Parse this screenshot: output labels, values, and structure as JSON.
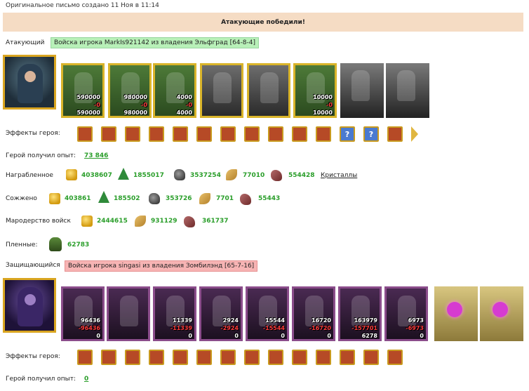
{
  "header": {
    "created_text": "Оригинальное письмо создано 11 Ноя в 11:14"
  },
  "banner": {
    "text": "Атакующие победили!"
  },
  "attacker": {
    "label": "Атакующий",
    "army_text": "Войска игрока MarkIs921142 из владения Эльфград [64-8-4]",
    "units": [
      {
        "icon": "elf-rider-unit-icon",
        "before": "590000",
        "loss": "-0",
        "after": "590000"
      },
      {
        "icon": "elf-archer-unit-icon",
        "before": "980000",
        "loss": "-0",
        "after": "980000"
      },
      {
        "icon": "elf-warrior-unit-icon",
        "before": "4000",
        "loss": "-0",
        "after": "4000"
      },
      {
        "icon": "griffin-unit-icon",
        "before": "",
        "loss": "",
        "after": ""
      },
      {
        "icon": "shadow-archer-unit-icon",
        "before": "",
        "loss": "",
        "after": ""
      },
      {
        "icon": "elf-lord-unit-icon",
        "before": "10000",
        "loss": "-0",
        "after": "10000"
      },
      {
        "icon": "hooded-knight-unit-icon",
        "before": "",
        "loss": "",
        "after": ""
      },
      {
        "icon": "grey-mage-unit-icon",
        "before": "",
        "loss": "",
        "after": ""
      }
    ],
    "effects_label": "Эффекты героя:",
    "exp_label": "Герой получил опыт:",
    "exp_value": "73 846",
    "loot_label": "Награбленное",
    "loot": [
      "4038607",
      "1855017",
      "3537254",
      "77010",
      "554428"
    ],
    "crystals_link": "Кристаллы",
    "burned_label": "Сожжено",
    "burned": [
      "403861",
      "185502",
      "353726",
      "7701",
      "55443"
    ],
    "marauder_label": "Мародерство войск",
    "marauder": [
      "2444615",
      "931129",
      "361737"
    ],
    "captives_label": "Пленные:",
    "captives_value": "62783"
  },
  "defender": {
    "label": "Защищающийся",
    "army_text": "Войска игрока singasi из владения Зомбилэнд [65-7-16]",
    "units": [
      {
        "icon": "ghoul-unit-icon",
        "before": "96436",
        "loss": "-96436",
        "after": "0"
      },
      {
        "icon": "shadow-reaper-unit-icon",
        "before": "",
        "loss": "",
        "after": ""
      },
      {
        "icon": "bone-dragon-unit-icon",
        "before": "11339",
        "loss": "-11339",
        "after": "0"
      },
      {
        "icon": "banshee-unit-icon",
        "before": "2924",
        "loss": "-2924",
        "after": "0"
      },
      {
        "icon": "dark-archer-unit-icon",
        "before": "15544",
        "loss": "-15544",
        "after": "0"
      },
      {
        "icon": "lich-unit-icon",
        "before": "16720",
        "loss": "-16720",
        "after": "0"
      },
      {
        "icon": "death-knight-unit-icon",
        "before": "163979",
        "loss": "-157701",
        "after": "6278"
      },
      {
        "icon": "demon-unit-icon",
        "before": "6973",
        "loss": "-6973",
        "after": "0"
      },
      {
        "icon": "soul-crystal-icon",
        "before": "",
        "loss": "",
        "after": ""
      },
      {
        "icon": "soul-crystal-icon",
        "before": "",
        "loss": "",
        "after": ""
      }
    ],
    "effects_label": "Эффекты героя:",
    "exp_label": "Герой получил опыт:",
    "exp_value": "0"
  },
  "attacker_effects": [
    "bag-icon",
    "helmet-icon",
    "dice-icon",
    "shield-icon",
    "handshake-icon",
    "sword-icon",
    "sword-icon",
    "hand-icon",
    "mask-icon",
    "sigil-icon",
    "armor-icon",
    "question-icon",
    "question-icon",
    "orb-icon"
  ],
  "defender_effects": [
    "skull-icon",
    "scroll-icon",
    "bow-icon",
    "heart-icon",
    "heart-icon",
    "dagger-icon",
    "potion-icon",
    "potion-icon",
    "mask-icon",
    "cross-icon",
    "rune-icon",
    "shield-icon",
    "gear-icon",
    "sword-icon"
  ],
  "colors": {
    "positive": "#2a9e2a",
    "negative": "#ff3b3b",
    "banner": "#f5dcc4",
    "attacker_tag": "#b8f0b8",
    "defender_tag": "#f7b4b4"
  }
}
